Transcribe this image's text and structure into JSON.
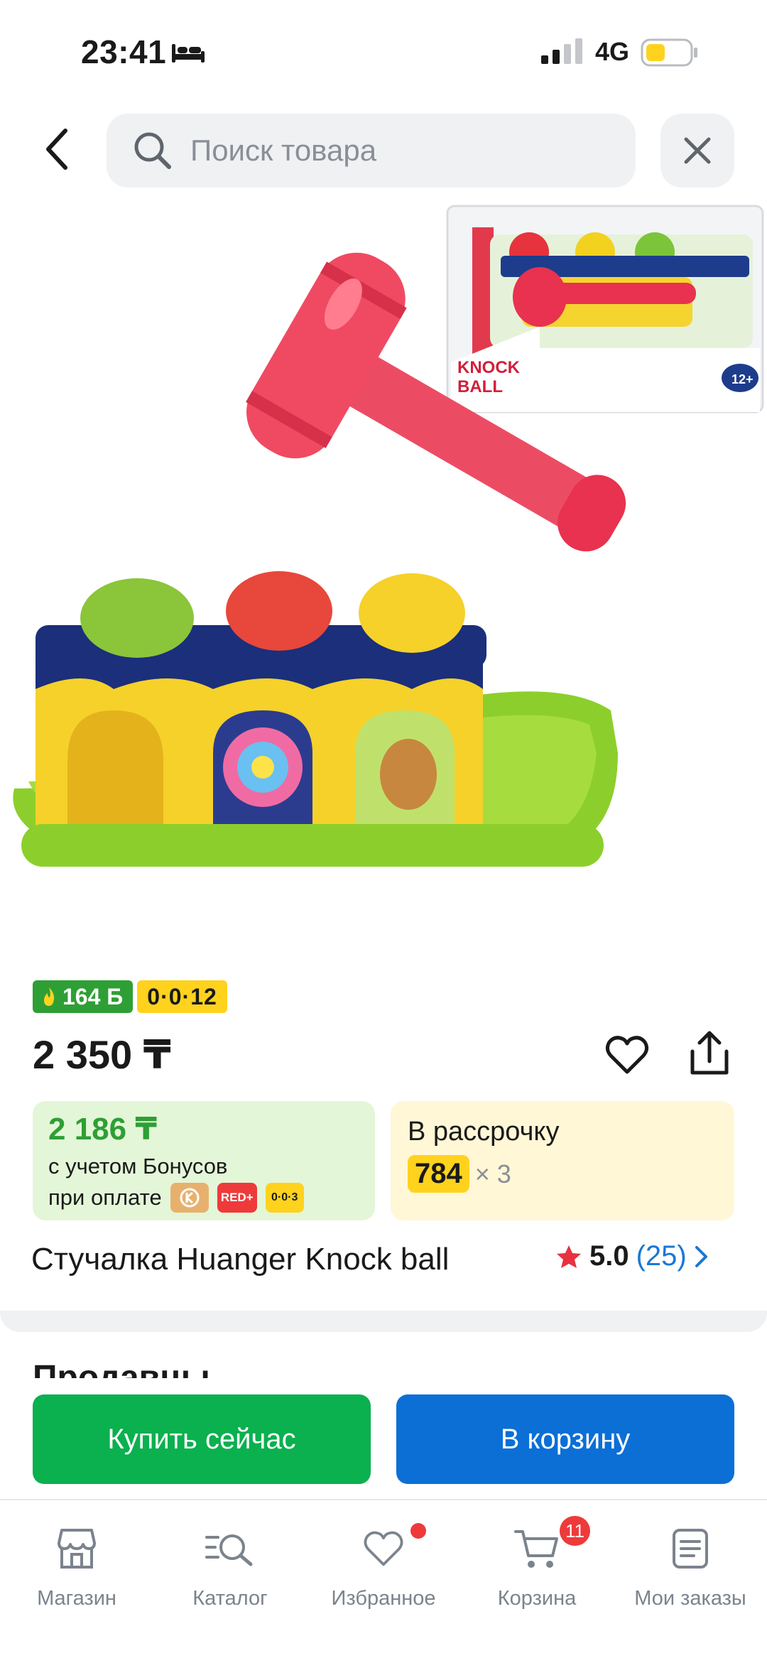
{
  "status_bar": {
    "time": "23:41",
    "network": "4G"
  },
  "header": {
    "search_placeholder": "Поиск товара"
  },
  "product": {
    "box_brand": "KNOCK BALL",
    "bonus_badge": "164 Б",
    "installment_badge": "0·0·12",
    "price": "2 350 ₸",
    "bonus_card": {
      "amount": "2 186 ₸",
      "line1": "с учетом Бонусов",
      "line2": "при оплате",
      "pay_red": "RED+",
      "pay_inst": "0·0·3"
    },
    "installment_card": {
      "title": "В рассрочку",
      "monthly": "784",
      "times": "× 3"
    },
    "name": "Стучалка Huanger Knock ball",
    "rating": "5.0",
    "reviews": "(25)"
  },
  "sellers": {
    "title": "Продавцы"
  },
  "actions": {
    "buy_now": "Купить сейчас",
    "add_to_cart": "В корзину"
  },
  "bottom_nav": {
    "items": [
      {
        "label": "Магазин",
        "icon": "shop-icon"
      },
      {
        "label": "Каталог",
        "icon": "catalog-search-icon"
      },
      {
        "label": "Избранное",
        "icon": "heart-icon"
      },
      {
        "label": "Корзина",
        "icon": "cart-icon",
        "badge": "11"
      },
      {
        "label": "Мои заказы",
        "icon": "orders-icon"
      }
    ]
  },
  "colors": {
    "primary_green": "#0bb04f",
    "primary_blue": "#0b6fd6",
    "bonus_green": "#2e9f35",
    "installment_yellow": "#ffd21e",
    "alert_red": "#ee3a3a"
  }
}
